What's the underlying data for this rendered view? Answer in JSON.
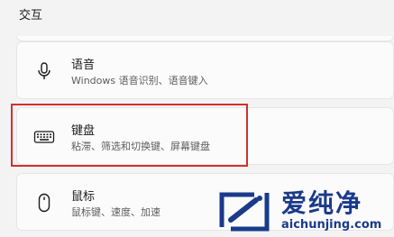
{
  "section": {
    "title": "交互"
  },
  "items": [
    {
      "title": "语音",
      "subtitle": "Windows 语音识别、语音键入",
      "icon": "microphone-icon"
    },
    {
      "title": "键盘",
      "subtitle": "粘滞、筛选和切换键、屏幕键盘",
      "icon": "keyboard-icon",
      "highlighted": true
    },
    {
      "title": "鼠标",
      "subtitle": "鼠标键、速度、加速",
      "icon": "mouse-icon"
    }
  ],
  "watermark": {
    "cn": "爱纯净",
    "en": "aichunjing.com"
  },
  "colors": {
    "highlight": "#d32f2f",
    "watermark": "#1a3a8a",
    "background": "#f3f3f3",
    "card": "#fbfbfb"
  }
}
